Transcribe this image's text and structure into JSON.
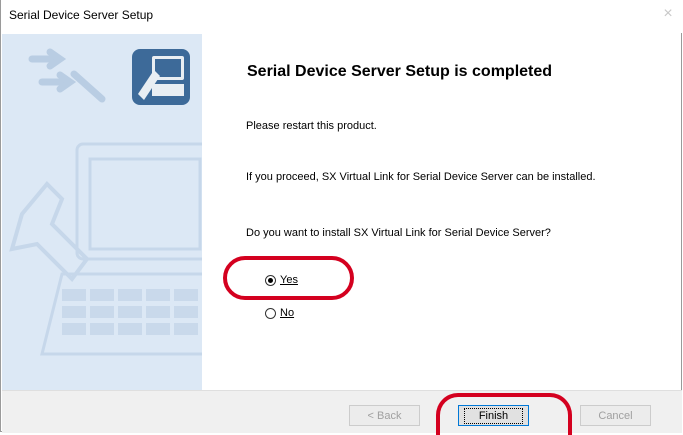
{
  "window": {
    "title": "Serial Device Server Setup",
    "close_glyph": "×"
  },
  "content": {
    "heading": "Serial Device Server Setup is completed",
    "restart_text": "Please restart this product.",
    "proceed_text": "If you proceed, SX Virtual Link for Serial Device Server can be installed.",
    "question_text": "Do you want to install SX Virtual Link for Serial Device Server?",
    "options": [
      {
        "label": "Yes",
        "selected": true
      },
      {
        "label": "No",
        "selected": false
      }
    ]
  },
  "buttons": {
    "back": "< Back",
    "finish": "Finish",
    "cancel": "Cancel"
  },
  "colors": {
    "annotation": "#d4001f",
    "sidebar": "#dce8f5",
    "focus_border": "#0078d7"
  }
}
